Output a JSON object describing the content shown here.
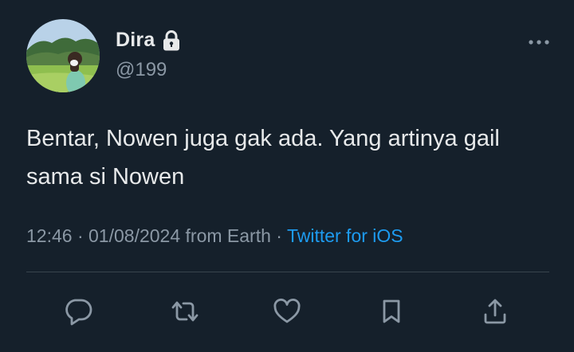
{
  "user": {
    "display_name": "Dira",
    "handle": "@199",
    "avatar_icon": "profile-photo",
    "protected_icon": "lock-icon"
  },
  "tweet": {
    "text": "Bentar, Nowen juga gak ada. Yang artinya gail sama si Nowen",
    "time": "12:46",
    "separator1": " · ",
    "date": "01/08/2024",
    "location": " from Earth",
    "separator2": " · ",
    "source": "Twitter for iOS"
  },
  "actions": [
    {
      "name": "reply",
      "icon": "comment-icon"
    },
    {
      "name": "retweet",
      "icon": "retweet-icon"
    },
    {
      "name": "like",
      "icon": "heart-icon"
    },
    {
      "name": "bookmark",
      "icon": "bookmark-icon"
    },
    {
      "name": "share",
      "icon": "share-icon"
    }
  ],
  "colors": {
    "background": "#15202b",
    "text": "#e7e9ea",
    "secondary": "#8b98a5",
    "accent": "#1d9bf0",
    "divider": "#38444d"
  }
}
